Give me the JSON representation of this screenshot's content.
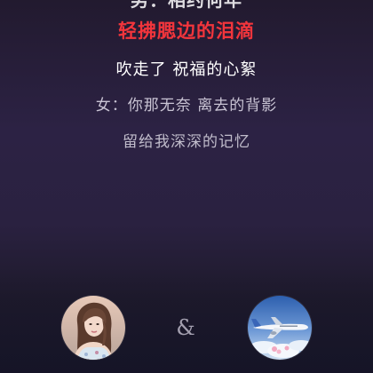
{
  "lyrics": {
    "previous": "男：相约何年",
    "active": "轻拂腮边的泪滴",
    "next": "吹走了 祝福的心絮",
    "upcoming_1": "女：你那无奈 离去的背影",
    "upcoming_2": "留给我深深的记忆"
  },
  "duet": {
    "separator": "&",
    "left_avatar_icon": "user-avatar-photo",
    "right_avatar_icon": "airplane-avatar-photo"
  },
  "colors": {
    "active_lyric": "#f2353c",
    "background_top": "#221a2f",
    "background_bottom": "#17172a"
  }
}
